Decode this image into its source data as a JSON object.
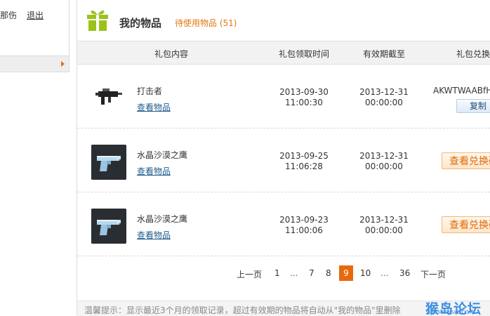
{
  "sidebar": {
    "user_suffix": "那伤",
    "logout": "退出"
  },
  "header": {
    "title": "我的物品",
    "subtitle": "待使用物品",
    "count": "(51)",
    "gift_color": "#9bc21a"
  },
  "table": {
    "columns": [
      "礼包内容",
      "礼包领取时间",
      "有效期截至",
      "礼包兑换"
    ],
    "rows": [
      {
        "name": "打击者",
        "view": "查看物品",
        "receive_date": "2013-09-30",
        "receive_time": "11:00:30",
        "expire_date": "2013-12-31",
        "expire_time": "00:00:00",
        "code": "AKWTWAABfHW",
        "action": "复制",
        "icon": "rifle-icon"
      },
      {
        "name": "水晶沙漠之鹰",
        "view": "查看物品",
        "receive_date": "2013-09-25",
        "receive_time": "11:06:28",
        "expire_date": "2013-12-31",
        "expire_time": "00:00:00",
        "action": "查看兑换码",
        "icon": "pistol-icon"
      },
      {
        "name": "水晶沙漠之鹰",
        "view": "查看物品",
        "receive_date": "2013-09-23",
        "receive_time": "11:00:06",
        "expire_date": "2013-12-31",
        "expire_time": "00:00:00",
        "action": "查看兑换码",
        "icon": "pistol-icon"
      }
    ]
  },
  "pagination": {
    "prev": "上一页",
    "p1": "1",
    "e1": "...",
    "p7": "7",
    "p8": "8",
    "current": "9",
    "p10": "10",
    "e2": "...",
    "p36": "36",
    "next": "下一页",
    "accent": "#e8690b"
  },
  "footer": {
    "tip": "温馨提示：显示最近3个月的领取记录，超过有效期的物品将自动从\"我的物品\"里删除",
    "watermark": "猴岛论坛",
    "watermark_url": "BBS.HOUDAO.COM"
  }
}
